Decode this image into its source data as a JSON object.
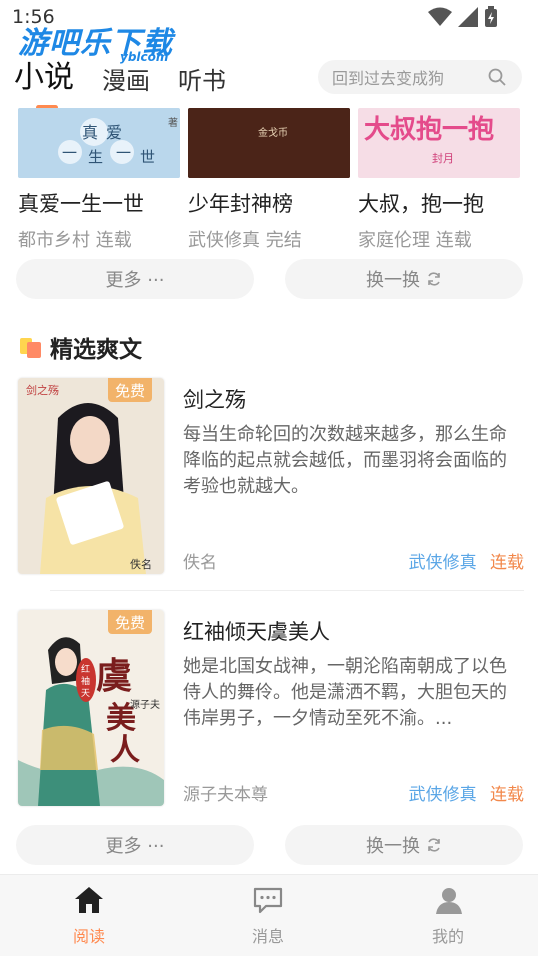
{
  "status": {
    "time": "1:56",
    "watermark": "游吧乐下载",
    "watermark_sub": "yblcom"
  },
  "tabs": [
    {
      "label": "小说",
      "active": true
    },
    {
      "label": "漫画",
      "active": false
    },
    {
      "label": "听书",
      "active": false
    }
  ],
  "search": {
    "placeholder": "回到过去变成狗"
  },
  "top_books": [
    {
      "title": "真爱一生一世",
      "genre": "都市乡村",
      "status": "连载",
      "cover_text": "真爱一生一世"
    },
    {
      "title": "少年封神榜",
      "genre": "武侠修真",
      "status": "完结",
      "cover_text": "金戈币"
    },
    {
      "title": "大叔，抱一抱",
      "genre": "家庭伦理",
      "status": "连载",
      "cover_text": "大叔抱一抱"
    }
  ],
  "top_buttons": {
    "more": "更多 ···",
    "refresh": "换一换"
  },
  "section": {
    "title": "精选爽文"
  },
  "featured": [
    {
      "title": "剑之殇",
      "desc": "每当生命轮回的次数越来越多，那么生命降临的起点就会越低，而墨羽将会面临的考验也就越大。",
      "author": "佚名",
      "genre": "武侠修真",
      "status": "连载",
      "badge": "免费",
      "cover_text": "佚名"
    },
    {
      "title": "红袖倾天虞美人",
      "desc": "她是北国女战神，一朝沦陷南朝成了以色侍人的舞伶。他是潇洒不羁，大胆包天的伟岸男子，一夕情动至死不渝。...",
      "author": "源子夫本尊",
      "genre": "武侠修真",
      "status": "连载",
      "badge": "免费",
      "cover_text": "虞美人"
    }
  ],
  "bottom_buttons": {
    "more": "更多 ···",
    "refresh": "换一换"
  },
  "nav": [
    {
      "label": "阅读",
      "icon": "home-icon",
      "active": true
    },
    {
      "label": "消息",
      "icon": "message-icon",
      "active": false
    },
    {
      "label": "我的",
      "icon": "user-icon",
      "active": false
    }
  ],
  "colors": {
    "accent": "#ff8a50",
    "genre_blue": "#5aa6e6",
    "status_orange": "#f2884b",
    "badge": "#f2b36a"
  }
}
